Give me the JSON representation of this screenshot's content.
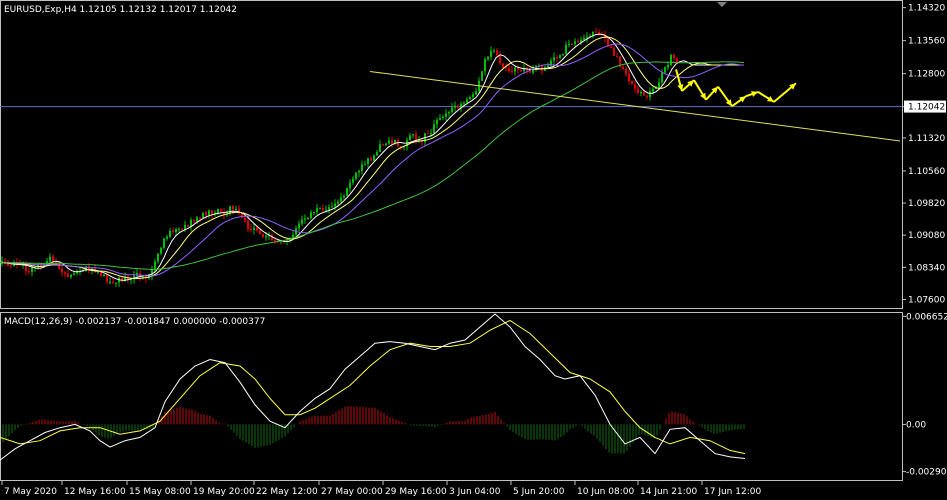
{
  "header": {
    "symbol_line": "EURUSD,Exp,H4  1.12105 1.12132 1.12017 1.12042",
    "macd_line": "MACD(12,26,9) -0.002137 -0.001847 0.000000 -0.000377"
  },
  "colors": {
    "background": "#000000",
    "grid_frame": "#c0c0c0",
    "bull": "#00c000",
    "bear": "#e00000",
    "ma_fast": "#ffffff",
    "ma_mid": "#ffff80",
    "ma_slow": "#9060ff",
    "ma_long": "#40c040",
    "trendline": "#e0e060",
    "projection": "#ffff00",
    "price_line": "#6070d0",
    "macd_main": "#ffffff",
    "macd_signal": "#ffff40",
    "osma_pos": "#c01010",
    "osma_neg": "#107010"
  },
  "price_axis": {
    "ticks": [
      "1.14320",
      "1.13560",
      "1.12800",
      "1.12042",
      "1.11320",
      "1.10560",
      "1.09820",
      "1.09080",
      "1.08340",
      "1.07600"
    ],
    "current": "1.12042"
  },
  "macd_axis": {
    "ticks": [
      "0.006652",
      "0.00",
      "-0.002905"
    ]
  },
  "time_axis": {
    "ticks": [
      "7 May 2020",
      "12 May 16:00",
      "15 May 08:00",
      "19 May 20:00",
      "22 May 12:00",
      "27 May 00:00",
      "29 May 16:00",
      "3 Jun 04:00",
      "5 Jun 20:00",
      "10 Jun 08:00",
      "14 Jun 21:00",
      "17 Jun 12:00"
    ]
  },
  "chart_data": {
    "type": "candlestick",
    "symbol": "EURUSD,Exp",
    "timeframe": "H4",
    "last_ohlc": {
      "open": 1.12105,
      "high": 1.12132,
      "low": 1.12017,
      "close": 1.12042
    },
    "ylim": [
      1.0745,
      1.1445
    ],
    "close_path": [
      [
        0,
        1.0845
      ],
      [
        10,
        1.0838
      ],
      [
        20,
        1.0843
      ],
      [
        30,
        1.0825
      ],
      [
        40,
        1.0838
      ],
      [
        50,
        1.0858
      ],
      [
        58,
        1.0838
      ],
      [
        66,
        1.0815
      ],
      [
        72,
        1.0825
      ],
      [
        82,
        1.0832
      ],
      [
        100,
        1.082
      ],
      [
        112,
        1.08
      ],
      [
        125,
        1.0808
      ],
      [
        140,
        1.0818
      ],
      [
        150,
        1.0815
      ],
      [
        160,
        1.088
      ],
      [
        168,
        1.0915
      ],
      [
        178,
        1.0918
      ],
      [
        188,
        1.0935
      ],
      [
        196,
        1.095
      ],
      [
        205,
        1.0955
      ],
      [
        215,
        1.0962
      ],
      [
        225,
        1.096
      ],
      [
        232,
        1.097
      ],
      [
        240,
        1.095
      ],
      [
        248,
        1.093
      ],
      [
        255,
        1.0918
      ],
      [
        262,
        1.0905
      ],
      [
        270,
        1.09
      ],
      [
        278,
        1.0888
      ],
      [
        286,
        1.0895
      ],
      [
        295,
        1.0918
      ],
      [
        305,
        1.0945
      ],
      [
        315,
        1.0965
      ],
      [
        325,
        1.0962
      ],
      [
        335,
        1.0985
      ],
      [
        345,
        1.1005
      ],
      [
        355,
        1.1045
      ],
      [
        365,
        1.1075
      ],
      [
        375,
        1.1095
      ],
      [
        385,
        1.1125
      ],
      [
        395,
        1.112
      ],
      [
        405,
        1.1118
      ],
      [
        412,
        1.1135
      ],
      [
        422,
        1.113
      ],
      [
        432,
        1.115
      ],
      [
        440,
        1.1175
      ],
      [
        450,
        1.1195
      ],
      [
        458,
        1.121
      ],
      [
        466,
        1.122
      ],
      [
        474,
        1.123
      ],
      [
        482,
        1.129
      ],
      [
        488,
        1.1325
      ],
      [
        494,
        1.134
      ],
      [
        500,
        1.131
      ],
      [
        508,
        1.129
      ],
      [
        518,
        1.1295
      ],
      [
        526,
        1.1285
      ],
      [
        536,
        1.1295
      ],
      [
        546,
        1.129
      ],
      [
        556,
        1.1315
      ],
      [
        566,
        1.134
      ],
      [
        576,
        1.1355
      ],
      [
        586,
        1.137
      ],
      [
        596,
        1.1375
      ],
      [
        604,
        1.136
      ],
      [
        612,
        1.1335
      ],
      [
        620,
        1.13
      ],
      [
        628,
        1.1265
      ],
      [
        634,
        1.124
      ],
      [
        642,
        1.123
      ],
      [
        650,
        1.1235
      ],
      [
        658,
        1.126
      ],
      [
        666,
        1.1295
      ],
      [
        672,
        1.133
      ],
      [
        678,
        1.13
      ]
    ],
    "moving_averages": [
      {
        "key": "ma_fast",
        "lag": 6
      },
      {
        "key": "ma_mid",
        "lag": 12
      },
      {
        "key": "ma_slow",
        "lag": 22
      },
      {
        "key": "ma_long",
        "lag": 60
      }
    ],
    "trendline": [
      [
        370,
        1.1285
      ],
      [
        900,
        1.1125
      ]
    ],
    "current_price": 1.12042,
    "projection": [
      [
        676,
        1.129
      ],
      [
        682,
        1.124
      ],
      [
        694,
        1.1265
      ],
      [
        706,
        1.122
      ],
      [
        718,
        1.125
      ],
      [
        732,
        1.1205
      ],
      [
        746,
        1.1228
      ],
      [
        758,
        1.1238
      ],
      [
        774,
        1.1215
      ],
      [
        796,
        1.1258
      ]
    ],
    "macd": {
      "ylim": [
        -0.0033,
        0.0068
      ],
      "main": [
        [
          0,
          -0.0022
        ],
        [
          15,
          -0.0015
        ],
        [
          30,
          -0.001
        ],
        [
          45,
          -0.0005
        ],
        [
          60,
          -0.0002
        ],
        [
          75,
          0.0
        ],
        [
          90,
          -0.0004
        ],
        [
          100,
          -0.001
        ],
        [
          110,
          -0.0014
        ],
        [
          125,
          -0.001
        ],
        [
          140,
          -0.0008
        ],
        [
          155,
          -0.0002
        ],
        [
          165,
          0.0014
        ],
        [
          180,
          0.0028
        ],
        [
          195,
          0.0036
        ],
        [
          210,
          0.004
        ],
        [
          225,
          0.0038
        ],
        [
          240,
          0.0026
        ],
        [
          255,
          0.0012
        ],
        [
          270,
          0.0002
        ],
        [
          285,
          -0.0002
        ],
        [
          300,
          0.0008
        ],
        [
          315,
          0.0016
        ],
        [
          330,
          0.0022
        ],
        [
          345,
          0.0034
        ],
        [
          360,
          0.0042
        ],
        [
          375,
          0.005
        ],
        [
          390,
          0.0051
        ],
        [
          405,
          0.005
        ],
        [
          420,
          0.0048
        ],
        [
          435,
          0.0046
        ],
        [
          450,
          0.005
        ],
        [
          465,
          0.0052
        ],
        [
          480,
          0.006
        ],
        [
          495,
          0.0068
        ],
        [
          510,
          0.006
        ],
        [
          525,
          0.0048
        ],
        [
          540,
          0.004
        ],
        [
          555,
          0.003
        ],
        [
          565,
          0.0028
        ],
        [
          580,
          0.003
        ],
        [
          595,
          0.0018
        ],
        [
          610,
          0.0
        ],
        [
          625,
          -0.0012
        ],
        [
          640,
          -0.0008
        ],
        [
          655,
          -0.0018
        ],
        [
          670,
          -0.0003
        ],
        [
          685,
          -0.0002
        ],
        [
          700,
          -0.001
        ],
        [
          715,
          -0.0018
        ],
        [
          730,
          -0.002
        ],
        [
          745,
          -0.0021
        ]
      ],
      "signal": [
        [
          0,
          -0.0008
        ],
        [
          20,
          -0.0012
        ],
        [
          40,
          -0.001
        ],
        [
          60,
          -0.0004
        ],
        [
          80,
          -0.0002
        ],
        [
          100,
          -0.0002
        ],
        [
          120,
          -0.0006
        ],
        [
          140,
          -0.0004
        ],
        [
          160,
          0.0002
        ],
        [
          180,
          0.0016
        ],
        [
          200,
          0.003
        ],
        [
          220,
          0.0038
        ],
        [
          240,
          0.0036
        ],
        [
          255,
          0.0028
        ],
        [
          270,
          0.0016
        ],
        [
          285,
          0.0006
        ],
        [
          300,
          0.0006
        ],
        [
          315,
          0.001
        ],
        [
          330,
          0.0016
        ],
        [
          350,
          0.0024
        ],
        [
          370,
          0.0036
        ],
        [
          390,
          0.0046
        ],
        [
          410,
          0.005
        ],
        [
          430,
          0.0048
        ],
        [
          450,
          0.0048
        ],
        [
          470,
          0.005
        ],
        [
          490,
          0.0058
        ],
        [
          510,
          0.0064
        ],
        [
          530,
          0.0056
        ],
        [
          550,
          0.0044
        ],
        [
          570,
          0.0032
        ],
        [
          590,
          0.0028
        ],
        [
          610,
          0.002
        ],
        [
          625,
          0.0008
        ],
        [
          640,
          -0.0002
        ],
        [
          655,
          -0.0008
        ],
        [
          670,
          -0.0012
        ],
        [
          690,
          -0.0008
        ],
        [
          710,
          -0.001
        ],
        [
          730,
          -0.0016
        ],
        [
          745,
          -0.0018
        ]
      ]
    }
  }
}
